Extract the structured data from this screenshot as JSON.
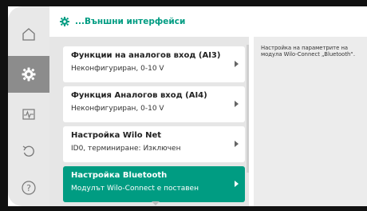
{
  "header": {
    "title": "...Външни интерфейси",
    "icon": "gear-icon",
    "accent": "#009c82"
  },
  "sidebar": {
    "items": [
      {
        "icon": "home-icon",
        "active": false
      },
      {
        "icon": "gear-icon",
        "active": true
      },
      {
        "icon": "diagnostics-icon",
        "active": false
      },
      {
        "icon": "restore-icon",
        "active": false
      },
      {
        "icon": "help-icon",
        "active": false
      }
    ]
  },
  "list": {
    "items": [
      {
        "title": "Функции на аналогов вход (AI3)",
        "subtitle": "Неконфигуриран, 0-10 V",
        "selected": false
      },
      {
        "title": "Функция Аналогов вход (AI4)",
        "subtitle": "Неконфигуриран, 0-10 V",
        "selected": false
      },
      {
        "title": "Настройка Wilo Net",
        "subtitle": "ID0, терминиране: Изключен",
        "selected": false
      },
      {
        "title": "Настройка Bluetooth",
        "subtitle": "Модулът Wilo-Connect е поставен",
        "selected": true
      }
    ]
  },
  "info": {
    "text": "Настройка на параметрите на модула Wilo-Connect „Bluetooth“."
  },
  "colors": {
    "selected": "#009c82",
    "sidebar_bg": "#e8e8e8",
    "sidebar_active": "#8c8c8c",
    "list_bg": "#e6e6e6"
  }
}
